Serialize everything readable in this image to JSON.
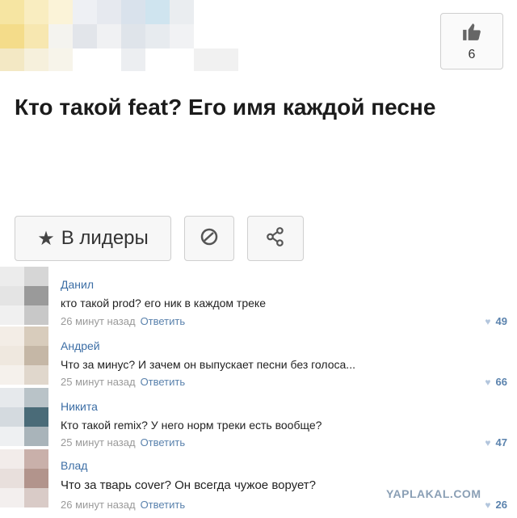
{
  "post": {
    "likes": "6",
    "title": "Кто такой feat? Его имя каждой песне"
  },
  "actions": {
    "leaders_label": "В лидеры"
  },
  "comments": [
    {
      "name": "Данил",
      "text": "кто такой prod? его ник в каждом треке",
      "time": "26 минут назад",
      "reply": "Ответить",
      "likes": "49"
    },
    {
      "name": "Андрей",
      "text": "Что за минус? И зачем он выпускает песни без голоса...",
      "time": "25 минут назад",
      "reply": "Ответить",
      "likes": "66"
    },
    {
      "name": "Никита",
      "text": "Кто такой remix? У него норм треки есть вообще?",
      "time": "25 минут назад",
      "reply": "Ответить",
      "likes": "47"
    },
    {
      "name": "Влад",
      "text": "Что за тварь cover? Он всегда чужое ворует?",
      "time": "26 минут назад",
      "reply": "Ответить",
      "likes": "26"
    }
  ],
  "watermark": "YAPLAKAL.COM",
  "icons": [
    "thumbs-up-icon",
    "star-icon",
    "block-icon",
    "share-icon",
    "heart-icon"
  ],
  "colors": {
    "link": "#3c6ea5",
    "accent_avatar": "#4a6b78"
  }
}
